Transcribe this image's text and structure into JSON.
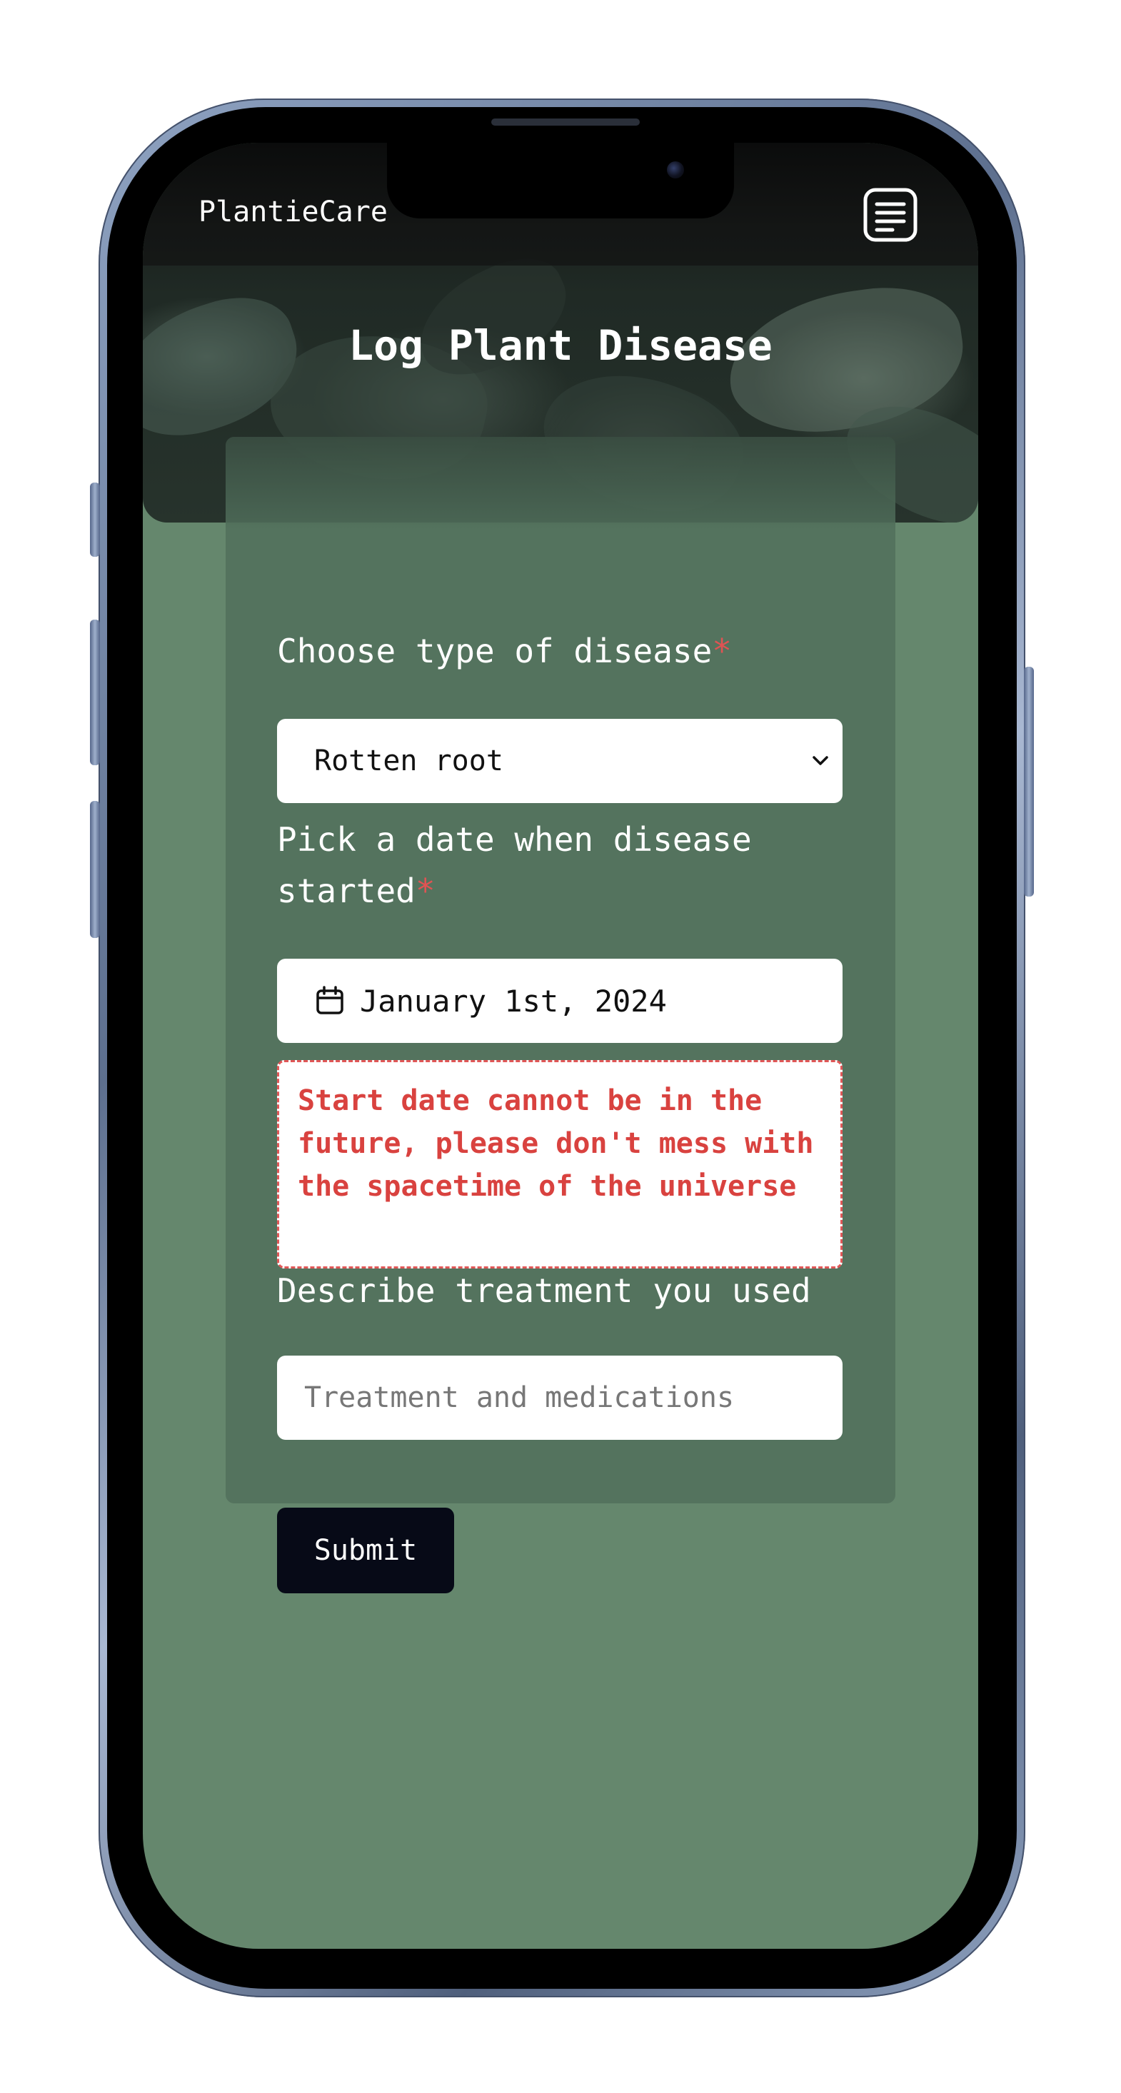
{
  "app": {
    "brand": "PlantieCare",
    "menu_icon": "menu-list-icon"
  },
  "header": {
    "title": "Log Plant Disease"
  },
  "form": {
    "disease_type": {
      "label": "Choose type of disease",
      "required_mark": "*",
      "selected": "Rotten root",
      "icon": "chevron-down-icon"
    },
    "start_date": {
      "label": "Pick a date when disease started",
      "required_mark": "*",
      "value": "January 1st, 2024",
      "icon": "calendar-icon"
    },
    "error": {
      "message": "Start date cannot be in the future, please don't mess with the spacetime of the universe"
    },
    "treatment": {
      "label": "Describe treatment you used",
      "placeholder": "Treatment and medications",
      "value": ""
    },
    "submit_label": "Submit"
  },
  "colors": {
    "background": "#65876d",
    "card": "#52705c",
    "required": "#e05353",
    "error": "#d9423f",
    "button": "#070a17"
  }
}
